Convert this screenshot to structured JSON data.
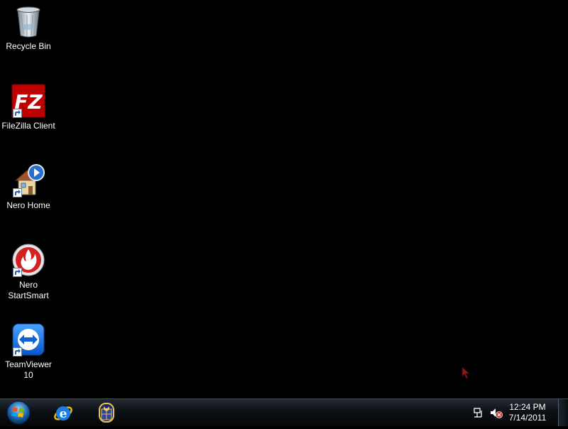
{
  "desktop": {
    "icons": [
      {
        "label": "Recycle Bin",
        "icon": "recycle-bin-icon"
      },
      {
        "label": "FileZilla Client",
        "icon": "filezilla-icon"
      },
      {
        "label": "Nero Home",
        "icon": "nero-home-icon"
      },
      {
        "label": "Nero StartSmart",
        "icon": "nero-startsmart-icon"
      },
      {
        "label": "TeamViewer 10",
        "icon": "teamviewer-icon"
      }
    ]
  },
  "taskbar": {
    "pinned": [
      {
        "icon": "start-orb-icon"
      },
      {
        "icon": "internet-explorer-icon"
      },
      {
        "icon": "app-launcher-icon"
      }
    ],
    "tray": {
      "network_icon": "network-icon",
      "volume_icon": "volume-muted-icon",
      "time": "12:24 PM",
      "date": "7/14/2011"
    }
  },
  "colors": {
    "desktop_background": "#000000",
    "taskbar": "#0d1115",
    "label_text": "#ffffff"
  }
}
